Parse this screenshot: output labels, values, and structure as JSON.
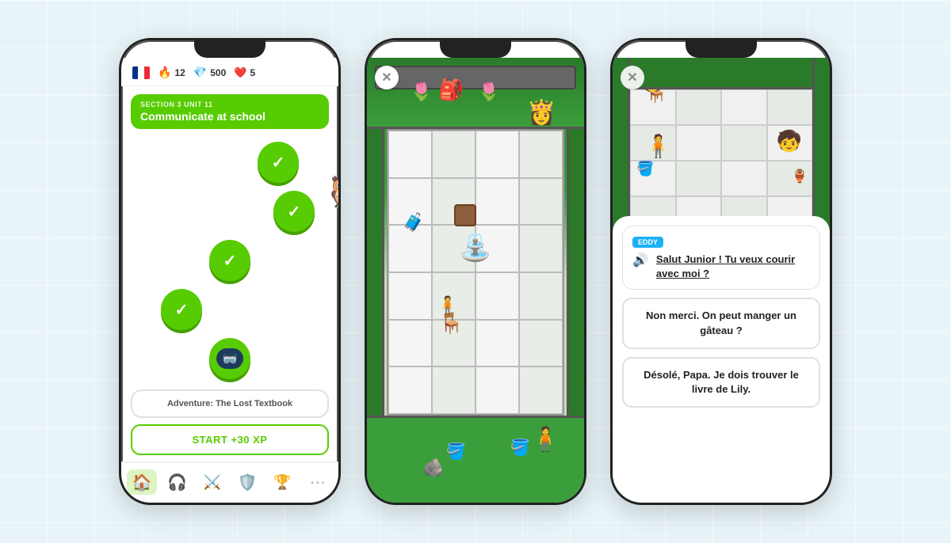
{
  "background": {
    "color": "#e8f4f8"
  },
  "phone1": {
    "stats": {
      "streak": "12",
      "gems": "500",
      "lives": "5"
    },
    "section": {
      "label": "SECTION 3 UNIT 11",
      "title": "Communicate at school"
    },
    "nodes": [
      {
        "type": "check",
        "completed": true
      },
      {
        "type": "mascot",
        "completed": true
      },
      {
        "type": "check",
        "completed": true
      },
      {
        "type": "check",
        "completed": true
      },
      {
        "type": "goggle",
        "locked": true
      }
    ],
    "adventure": {
      "label": "Adventure: The Lost Textbook",
      "btn": "START +30 XP"
    },
    "nav": [
      {
        "icon": "🏠",
        "label": "home",
        "active": true
      },
      {
        "icon": "🎧",
        "label": "headphones",
        "active": false
      },
      {
        "icon": "⚔️",
        "label": "battles",
        "active": false
      },
      {
        "icon": "🛡️",
        "label": "shield",
        "active": false
      },
      {
        "icon": "🏆",
        "label": "trophy",
        "active": false
      },
      {
        "icon": "⋯",
        "label": "more",
        "active": false
      }
    ]
  },
  "phone2": {
    "close_btn": "✕",
    "scene": "town_square"
  },
  "phone3": {
    "close_btn": "✕",
    "speaker_char": "EDDY",
    "dialog": {
      "speaker_label": "EDDY",
      "text": "Salut Junior ! Tu veux courir avec moi ?",
      "speaker_icon": "🔊"
    },
    "options": [
      {
        "text": "Non merci. On peut manger un gâteau ?"
      },
      {
        "text": "Désolé, Papa. Je dois trouver le livre de Lily."
      }
    ]
  }
}
